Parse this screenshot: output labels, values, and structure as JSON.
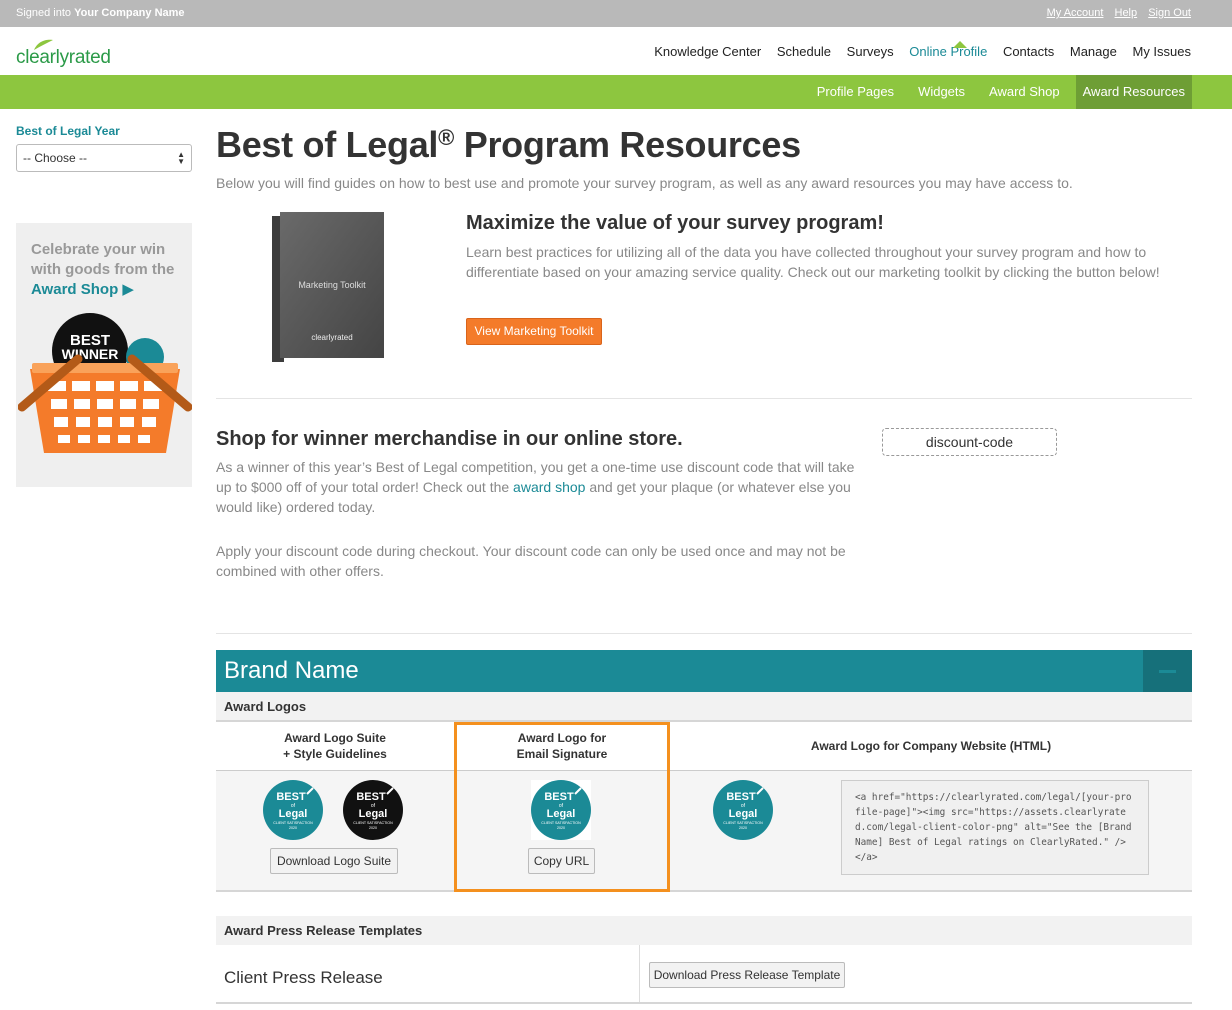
{
  "topbar": {
    "signed_prefix": "Signed into ",
    "company": "Your Company Name",
    "links": [
      "My Account",
      "Help",
      "Sign Out"
    ]
  },
  "logo": {
    "text": "clearlyrated"
  },
  "main_nav": [
    "Knowledge Center",
    "Schedule",
    "Surveys",
    "Online Profile",
    "Contacts",
    "Manage",
    "My Issues"
  ],
  "main_nav_active": "Online Profile",
  "sub_nav": [
    "Profile Pages",
    "Widgets",
    "Award Shop",
    "Award Resources"
  ],
  "sub_nav_active": "Award Resources",
  "sidebar": {
    "label": "Best of Legal Year",
    "select_value": "-- Choose --",
    "promo_line1": "Celebrate your win",
    "promo_line2": "with goods from the",
    "promo_link": "Award Shop",
    "promo_badge_top": "BEST",
    "promo_badge_bottom": "WINNER"
  },
  "page": {
    "title": "Best of Legal",
    "title_reg": "®",
    "title_rest": " Program Resources",
    "intro": "Below you will find guides on how to best use and promote your survey program, as well as any award resources you may have access to."
  },
  "marketing": {
    "book_title": "Marketing Toolkit",
    "book_logo": "clearlyrated",
    "title": "Maximize the value of your survey program!",
    "text": "Learn best practices for utilizing all of the data you have collected throughout your survey program and how to differentiate based on your amazing service quality. Check out our marketing toolkit by clicking the button below!",
    "button": "View Marketing Toolkit"
  },
  "shop": {
    "title": "Shop for winner merchandise in our online store.",
    "text_before": "As a winner of this year’s Best of Legal competition, you get a one-time use discount code that will take up to $000 off of your total order! Check out the ",
    "text_link": "award shop",
    "text_after": " and get your plaque (or whatever else you would like) ordered today.",
    "text2": "Apply your discount code during checkout. Your discount code can only be used once and may not be combined with other offers.",
    "discount_code": "discount-code"
  },
  "brand": {
    "name": "Brand Name",
    "award_logos_header": "Award Logos",
    "col1_line1": "Award Logo Suite",
    "col1_line2": "+ Style Guidelines",
    "col2_line1": "Award Logo for",
    "col2_line2": "Email Signature",
    "col3": "Award Logo for Company Website (HTML)",
    "download_logo_suite": "Download Logo Suite",
    "copy_url": "Copy URL",
    "html_code": "<a href=\"https://clearlyrated.com/legal/[your-profile-page]\"><img src=\"https://assets.clearlyrated.com/legal-client-color-png\" alt=\"See the [Brand Name] Best of Legal ratings on ClearlyRated.\" /></a>",
    "badge_best": "BEST",
    "badge_of": "of",
    "badge_legal": "Legal",
    "badge_sub": "CLIENT SATISFACTION",
    "badge_year": "2020",
    "press_header": "Award Press Release Templates",
    "press_label": "Client Press Release",
    "press_button": "Download Press Release Template"
  },
  "colors": {
    "teal": "#1b8a96",
    "green": "#8dc63f",
    "orange": "#f47b2a",
    "highlight": "#f4901e"
  }
}
